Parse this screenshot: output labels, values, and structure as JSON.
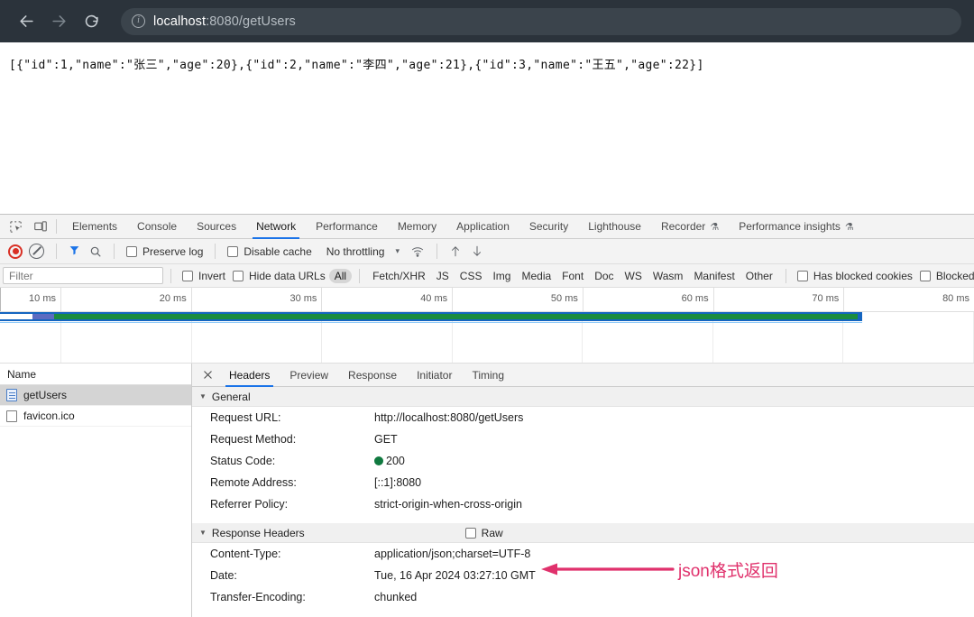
{
  "browser": {
    "back_icon": "back-arrow-icon",
    "forward_icon": "forward-arrow-icon",
    "reload_icon": "reload-icon",
    "info_icon": "info-circle-icon",
    "url_host": "localhost",
    "url_path": ":8080/getUsers",
    "url_full": "localhost:8080/getUsers"
  },
  "page": {
    "json_response": "[{\"id\":1,\"name\":\"张三\",\"age\":20},{\"id\":2,\"name\":\"李四\",\"age\":21},{\"id\":3,\"name\":\"王五\",\"age\":22}]"
  },
  "devtools": {
    "tabs": [
      {
        "label": "Elements",
        "active": false
      },
      {
        "label": "Console",
        "active": false
      },
      {
        "label": "Sources",
        "active": false
      },
      {
        "label": "Network",
        "active": true
      },
      {
        "label": "Performance",
        "active": false
      },
      {
        "label": "Memory",
        "active": false
      },
      {
        "label": "Application",
        "active": false
      },
      {
        "label": "Security",
        "active": false
      },
      {
        "label": "Lighthouse",
        "active": false
      },
      {
        "label": "Recorder",
        "active": false,
        "flask": true
      },
      {
        "label": "Performance insights",
        "active": false,
        "flask": true
      }
    ],
    "toolbar": {
      "record_icon": "record-icon",
      "clear_icon": "clear-icon",
      "filter_icon": "filter-funnel-icon",
      "search_icon": "search-icon",
      "preserve_log": "Preserve log",
      "disable_cache": "Disable cache",
      "throttling": "No throttling",
      "throttle_caret": "▾",
      "wifi_icon": "network-conditions-icon",
      "import_icon": "import-har-icon",
      "export_icon": "export-har-icon"
    },
    "filter": {
      "placeholder": "Filter",
      "invert": "Invert",
      "hide_data_urls": "Hide data URLs",
      "types": [
        "All",
        "Fetch/XHR",
        "JS",
        "CSS",
        "Img",
        "Media",
        "Font",
        "Doc",
        "WS",
        "Wasm",
        "Manifest",
        "Other"
      ],
      "selected_type": "All",
      "has_blocked_cookies": "Has blocked cookies",
      "blocked_requests": "Blocked"
    },
    "timeline": {
      "ticks": [
        "10 ms",
        "20 ms",
        "30 ms",
        "40 ms",
        "50 ms",
        "60 ms",
        "70 ms",
        "80 ms"
      ]
    },
    "request_list": {
      "column_header": "Name",
      "rows": [
        {
          "name": "getUsers",
          "icon": "document-icon",
          "selected": true
        },
        {
          "name": "favicon.ico",
          "icon": "blank-file-icon",
          "selected": false
        }
      ]
    },
    "detail": {
      "close_icon": "close-icon",
      "tabs": [
        {
          "label": "Headers",
          "active": true
        },
        {
          "label": "Preview",
          "active": false
        },
        {
          "label": "Response",
          "active": false
        },
        {
          "label": "Initiator",
          "active": false
        },
        {
          "label": "Timing",
          "active": false
        }
      ],
      "general": {
        "title": "General",
        "rows": [
          {
            "key": "Request URL:",
            "value": "http://localhost:8080/getUsers"
          },
          {
            "key": "Request Method:",
            "value": "GET"
          },
          {
            "key": "Status Code:",
            "value": "200",
            "status_dot": "#10793f"
          },
          {
            "key": "Remote Address:",
            "value": "[::1]:8080"
          },
          {
            "key": "Referrer Policy:",
            "value": "strict-origin-when-cross-origin"
          }
        ]
      },
      "response_headers": {
        "title": "Response Headers",
        "raw_label": "Raw",
        "rows": [
          {
            "key": "Content-Type:",
            "value": "application/json;charset=UTF-8"
          },
          {
            "key": "Date:",
            "value": "Tue, 16 Apr 2024 03:27:10 GMT"
          },
          {
            "key": "Transfer-Encoding:",
            "value": "chunked"
          }
        ]
      }
    }
  },
  "annotation": {
    "text": "json格式返回",
    "color": "#e0316c"
  }
}
